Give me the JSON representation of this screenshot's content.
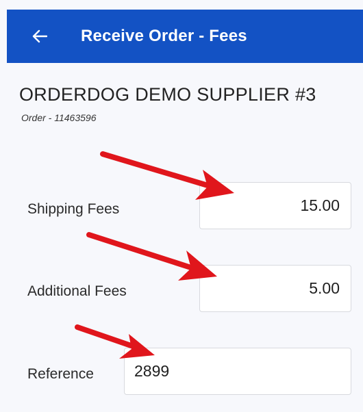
{
  "appbar": {
    "back_icon": "arrow-left-icon",
    "title": "Receive Order - Fees"
  },
  "supplier": {
    "name": "ORDERDOG DEMO SUPPLIER #3",
    "order_label": "Order - 11463596"
  },
  "fields": {
    "shipping": {
      "label": "Shipping Fees",
      "value": "15.00"
    },
    "additional": {
      "label": "Additional Fees",
      "value": "5.00"
    },
    "reference": {
      "label": "Reference",
      "value": "2899"
    }
  },
  "annotations": {
    "arrow_color": "#e0161c",
    "arrow_icon": "red-arrow-annotation"
  },
  "colors": {
    "appbar": "#1352c4",
    "background": "#f7f8fc"
  }
}
